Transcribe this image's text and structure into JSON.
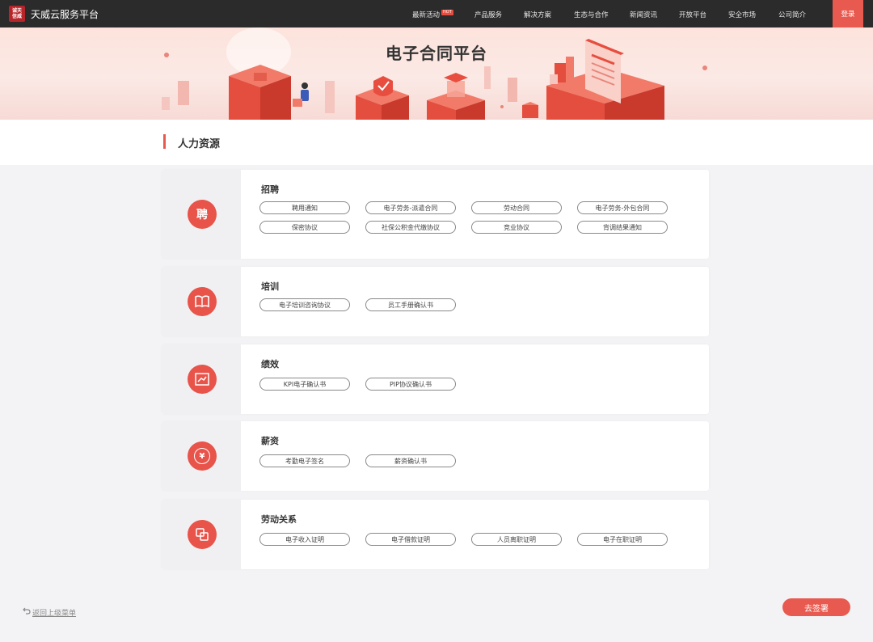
{
  "header": {
    "logo_text": "诚天信威",
    "brand": "天威云服务平台",
    "nav": [
      {
        "label": "最新活动",
        "hot": "HOT"
      },
      {
        "label": "产品服务"
      },
      {
        "label": "解决方案"
      },
      {
        "label": "生态与合作"
      },
      {
        "label": "新闻资讯"
      },
      {
        "label": "开放平台"
      },
      {
        "label": "安全市场"
      },
      {
        "label": "公司简介"
      }
    ],
    "login": "登录"
  },
  "banner": {
    "title": "电子合同平台"
  },
  "section": {
    "title": "人力资源"
  },
  "categories": [
    {
      "title": "招聘",
      "icon": "recruit-icon",
      "icon_text": "聘",
      "items": [
        "聘用通知",
        "电子劳务-派遣合同",
        "劳动合同",
        "电子劳务-外包合同",
        "保密协议",
        "社保公积金代缴协议",
        "竞业协议",
        "背调结果通知"
      ]
    },
    {
      "title": "培训",
      "icon": "book-icon",
      "items": [
        "电子培训咨询协议",
        "员工手册确认书"
      ]
    },
    {
      "title": "绩效",
      "icon": "chart-icon",
      "items": [
        "KPI电子确认书",
        "PIP协议确认书"
      ]
    },
    {
      "title": "薪资",
      "icon": "yen-icon",
      "icon_text": "¥",
      "items": [
        "考勤电子签名",
        "薪资确认书"
      ]
    },
    {
      "title": "劳动关系",
      "icon": "overlap-squares-icon",
      "items": [
        "电子收入证明",
        "电子借款证明",
        "人员离职证明",
        "电子在职证明"
      ]
    }
  ],
  "footer": {
    "back": "返回上级菜单",
    "go_sign": "去签署"
  },
  "colors": {
    "accent": "#e85a4f",
    "topbar": "#2b2b2b"
  }
}
